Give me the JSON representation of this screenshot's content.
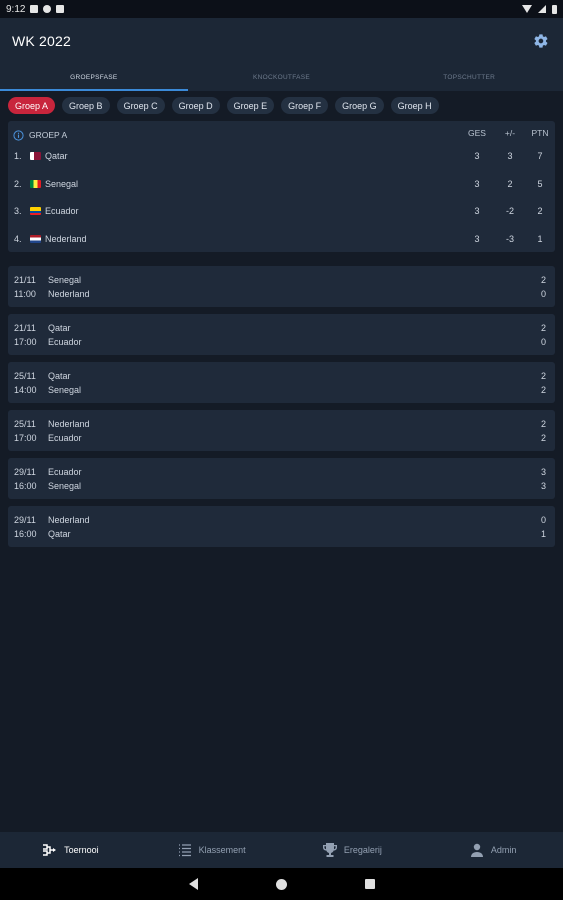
{
  "status_bar": {
    "time": "9:12"
  },
  "app_bar": {
    "title": "WK 2022",
    "settings_icon": "gear-icon"
  },
  "tabs": [
    {
      "label": "GROEPSFASE",
      "active": true
    },
    {
      "label": "KNOCKOUTFASE",
      "active": false
    },
    {
      "label": "TOPSCHUTTER",
      "active": false
    }
  ],
  "groups": [
    {
      "label": "Groep A",
      "active": true
    },
    {
      "label": "Groep B",
      "active": false
    },
    {
      "label": "Groep C",
      "active": false
    },
    {
      "label": "Groep D",
      "active": false
    },
    {
      "label": "Groep E",
      "active": false
    },
    {
      "label": "Groep F",
      "active": false
    },
    {
      "label": "Groep G",
      "active": false
    },
    {
      "label": "Groep H",
      "active": false
    }
  ],
  "standings": {
    "title": "GROEP A",
    "columns": {
      "played": "GES",
      "diff": "+/-",
      "points": "PTN"
    },
    "rows": [
      {
        "pos": "1.",
        "team": "Qatar",
        "flag": "qatar-flag",
        "played": "3",
        "diff": "3",
        "points": "7"
      },
      {
        "pos": "2.",
        "team": "Senegal",
        "flag": "senegal-flag",
        "played": "3",
        "diff": "2",
        "points": "5"
      },
      {
        "pos": "3.",
        "team": "Ecuador",
        "flag": "ecuador-flag",
        "played": "3",
        "diff": "-2",
        "points": "2"
      },
      {
        "pos": "4.",
        "team": "Nederland",
        "flag": "netherlands-flag",
        "played": "3",
        "diff": "-3",
        "points": "1"
      }
    ]
  },
  "matches": [
    {
      "date": "21/11",
      "time": "11:00",
      "home": "Senegal",
      "away": "Nederland",
      "home_score": "2",
      "away_score": "0"
    },
    {
      "date": "21/11",
      "time": "17:00",
      "home": "Qatar",
      "away": "Ecuador",
      "home_score": "2",
      "away_score": "0"
    },
    {
      "date": "25/11",
      "time": "14:00",
      "home": "Qatar",
      "away": "Senegal",
      "home_score": "2",
      "away_score": "2"
    },
    {
      "date": "25/11",
      "time": "17:00",
      "home": "Nederland",
      "away": "Ecuador",
      "home_score": "2",
      "away_score": "2"
    },
    {
      "date": "29/11",
      "time": "16:00",
      "home": "Ecuador",
      "away": "Senegal",
      "home_score": "3",
      "away_score": "3"
    },
    {
      "date": "29/11",
      "time": "16:00",
      "home": "Nederland",
      "away": "Qatar",
      "home_score": "0",
      "away_score": "1"
    }
  ],
  "bottom_nav": [
    {
      "label": "Toernooi",
      "icon": "bracket-icon",
      "active": true
    },
    {
      "label": "Klassement",
      "icon": "list-icon",
      "active": false
    },
    {
      "label": "Eregalerij",
      "icon": "trophy-icon",
      "active": false
    },
    {
      "label": "Admin",
      "icon": "person-icon",
      "active": false
    }
  ],
  "colors": {
    "accent": "#c8253c",
    "tab_indicator": "#3b8ad8",
    "card": "#1f2a3a",
    "background": "#141b26"
  }
}
